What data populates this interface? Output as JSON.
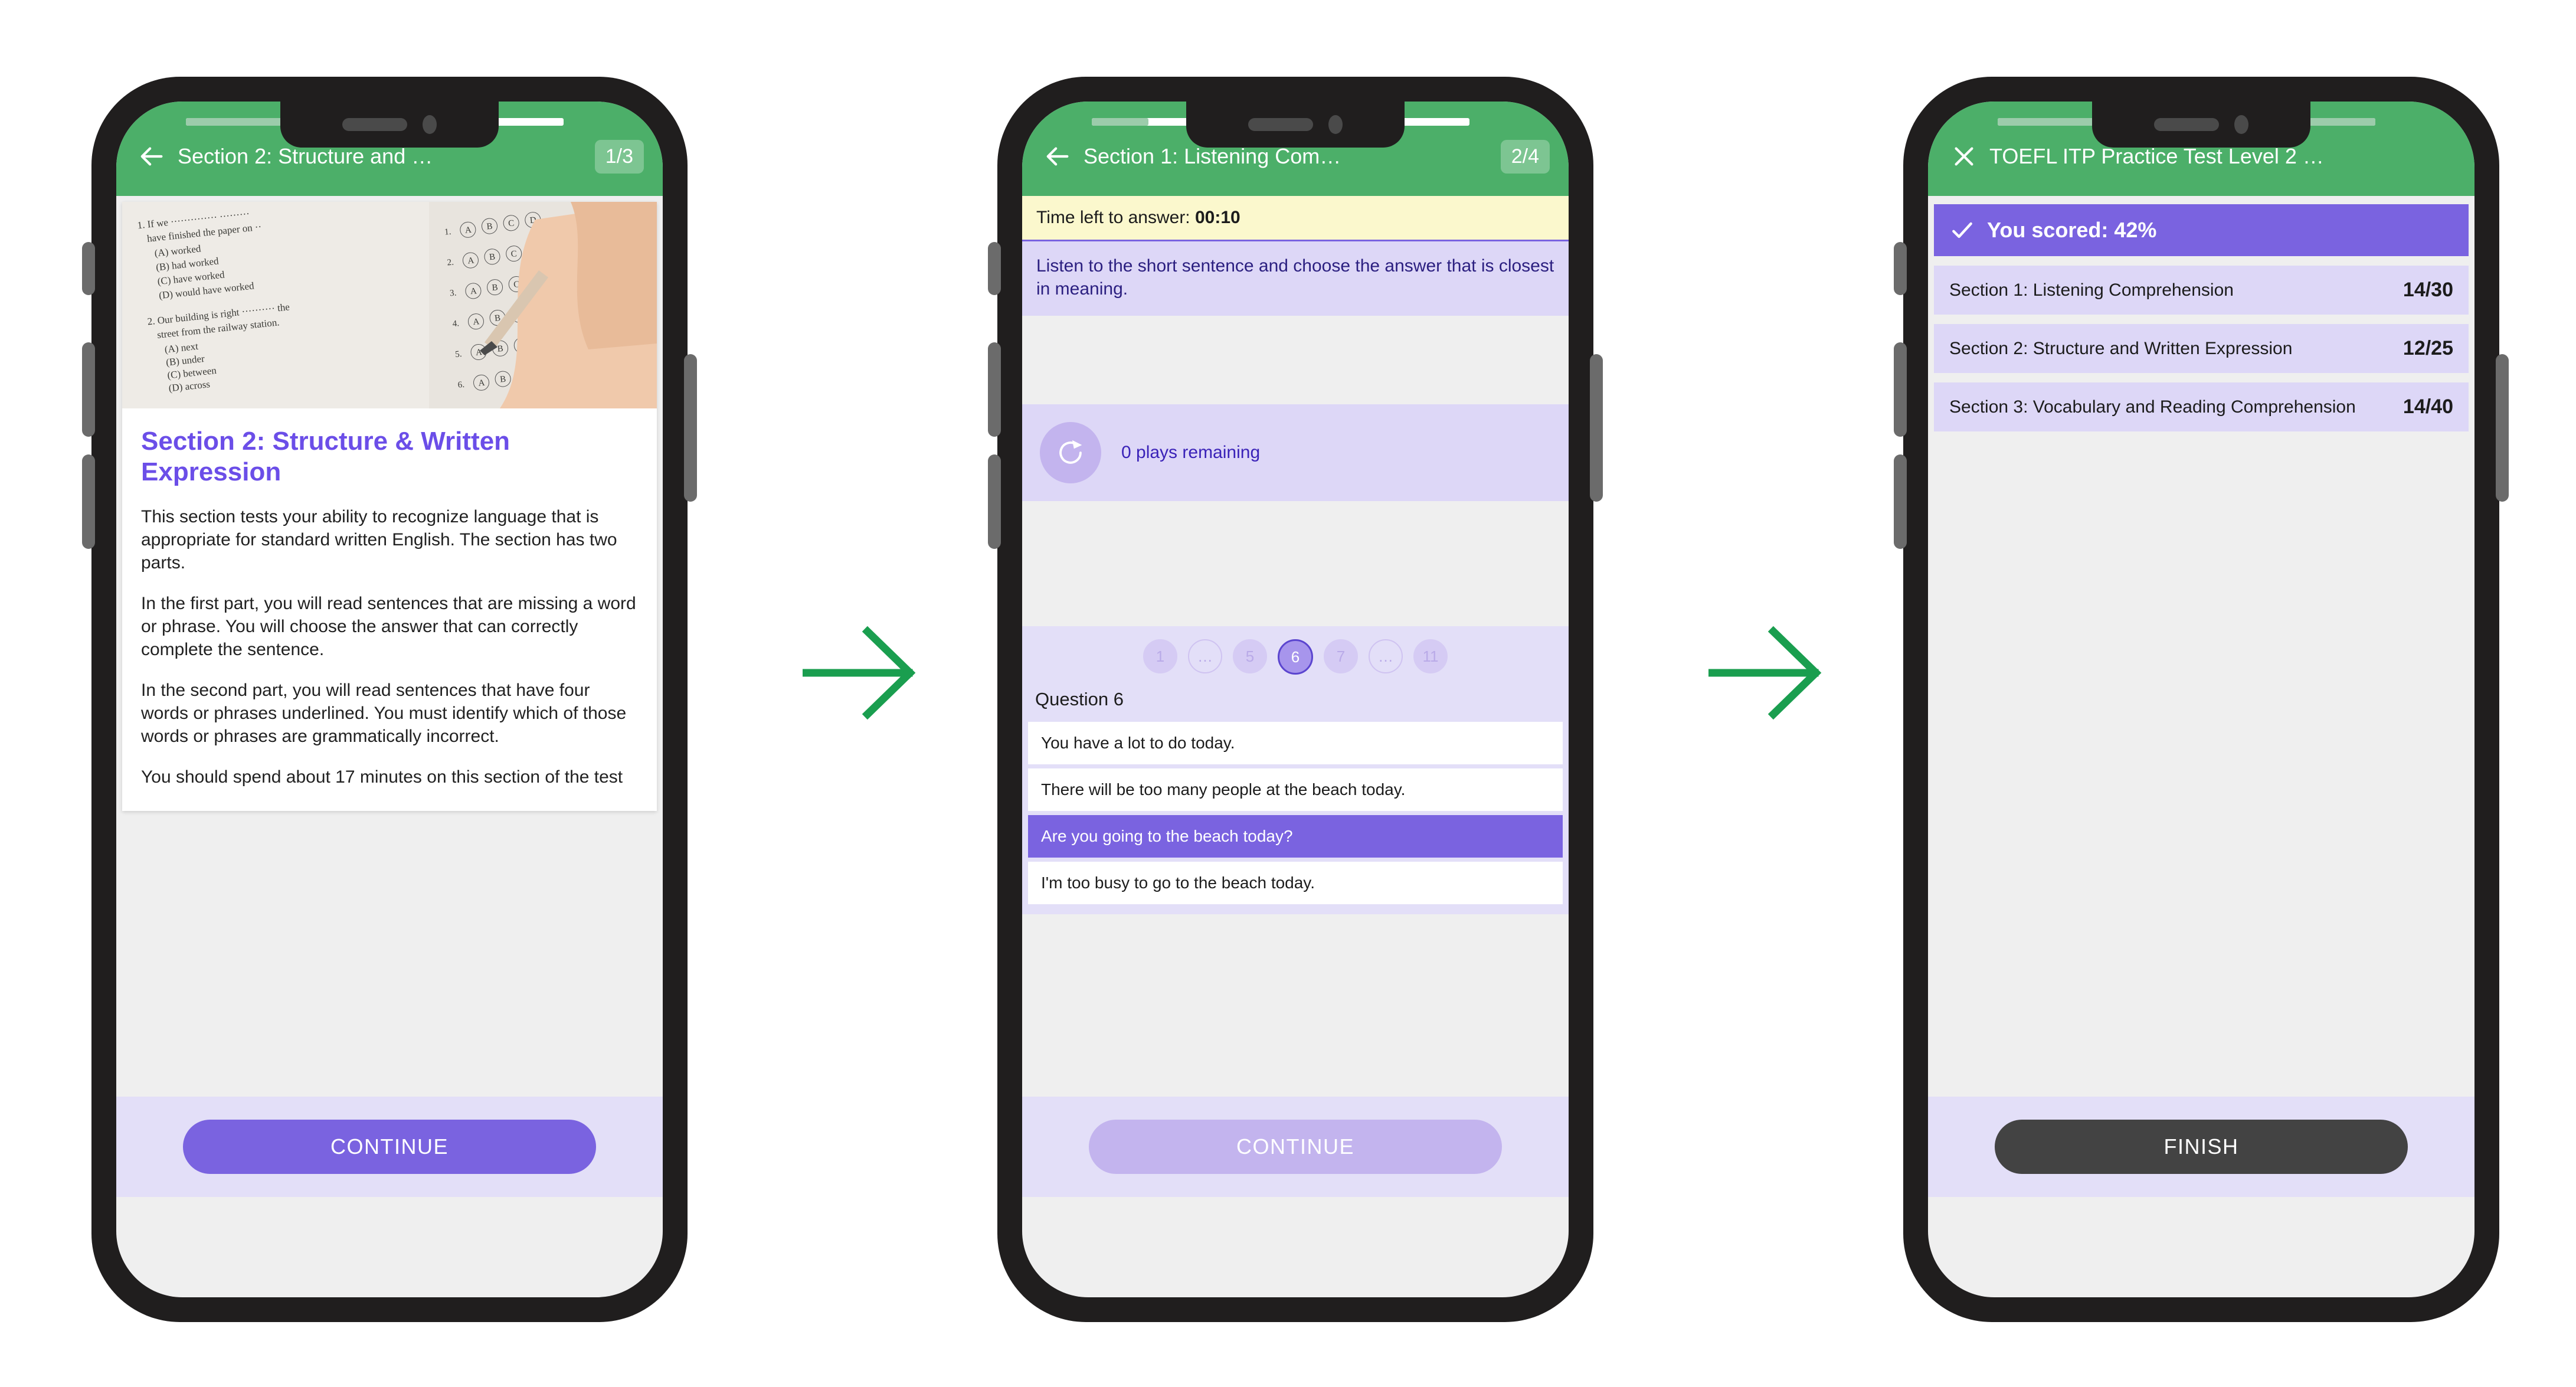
{
  "theme": {
    "appbar_green": "#4caf69",
    "accent_purple": "#7a63e0",
    "light_purple": "#ddd7f7",
    "footer_purple": "#e3dff8",
    "timer_yellow": "#fbf8cd",
    "dark_button": "#434343",
    "arrow_green": "#1a9e4f"
  },
  "screens": [
    {
      "id": "section-intro",
      "appbar": {
        "back_icon": "arrow-left-icon",
        "title": "Section 2: Structure and …",
        "step_badge": "1/3",
        "progress_percent": 33
      },
      "hero_image_alt": "exam-answer-sheet-photo",
      "section_title": "Section 2: Structure & Written Expression",
      "paragraphs": [
        "This section tests your ability to recognize language that is appropriate for standard written English. The section has two parts.",
        "In the first part, you will read sentences that are missing a word or phrase. You will choose the answer that can correctly complete the sentence.",
        "In the second part, you will read sentences that have four words or phrases underlined. You must identify which of those words or phrases are grammatically incorrect.",
        "You should spend about 17 minutes on this section of the test"
      ],
      "cta": {
        "label": "CONTINUE",
        "state": "primary"
      }
    },
    {
      "id": "listening-question",
      "appbar": {
        "back_icon": "arrow-left-icon",
        "title": "Section 1: Listening Com…",
        "step_badge": "2/4",
        "progress_percent": 15
      },
      "timer": {
        "prefix": "Time left to answer:",
        "value": "00:10"
      },
      "instruction": "Listen to the short sentence and choose the answer that is closest in meaning.",
      "audio": {
        "icon": "replay-icon",
        "plays_label": "0 plays remaining"
      },
      "pager": [
        {
          "label": "1",
          "state": "normal"
        },
        {
          "label": "…",
          "state": "empty"
        },
        {
          "label": "5",
          "state": "normal"
        },
        {
          "label": "6",
          "state": "active"
        },
        {
          "label": "7",
          "state": "normal"
        },
        {
          "label": "…",
          "state": "empty"
        },
        {
          "label": "11",
          "state": "normal"
        }
      ],
      "question_label": "Question 6",
      "options": [
        {
          "text": "You have a lot to do today.",
          "selected": false
        },
        {
          "text": "There will be too many people at the beach today.",
          "selected": false
        },
        {
          "text": "Are you going to the beach today?",
          "selected": true
        },
        {
          "text": "I'm too busy to go to the beach today.",
          "selected": false
        }
      ],
      "cta": {
        "label": "CONTINUE",
        "state": "disabled"
      }
    },
    {
      "id": "results",
      "appbar": {
        "back_icon": "close-icon",
        "title": "TOEFL ITP Practice Test Level 2 …",
        "step_badge": "",
        "progress_percent": 100
      },
      "score_banner": {
        "icon": "check-icon",
        "text": "You scored: 42%"
      },
      "section_scores": [
        {
          "label": "Section 1: Listening Comprehension",
          "score": "14/30"
        },
        {
          "label": "Section 2: Structure and Written Expression",
          "score": "12/25"
        },
        {
          "label": "Section 3: Vocabulary and Reading Comprehension",
          "score": "14/40"
        }
      ],
      "cta": {
        "label": "FINISH",
        "state": "dark"
      }
    }
  ],
  "flow_arrows": [
    {
      "name": "arrow-step-1-to-2",
      "icon": "arrow-right-icon"
    },
    {
      "name": "arrow-step-2-to-3",
      "icon": "arrow-right-icon"
    }
  ]
}
